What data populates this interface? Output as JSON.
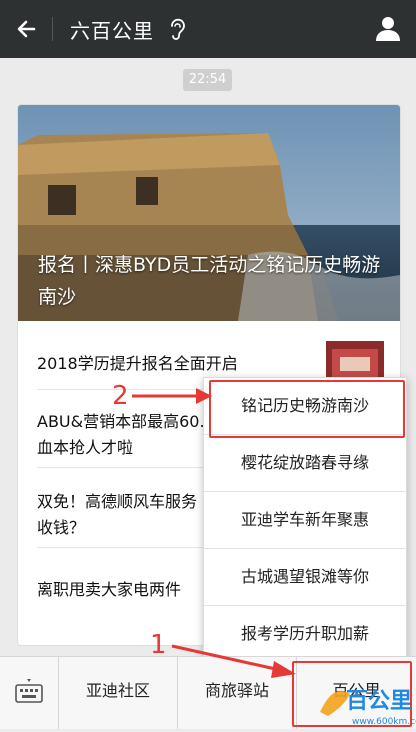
{
  "header": {
    "title": "六百公里"
  },
  "chat": {
    "time": "22:54"
  },
  "article": {
    "headline": "报名丨深惠BYD员工活动之铭记历史畅游南沙",
    "items": [
      {
        "text": "2018学历提升报名全面开启"
      },
      {
        "text": "ABU&营销本部最高60... 血本抢人才啦"
      },
      {
        "text": "双免！高德顺风车服务 不收钱？"
      },
      {
        "text": "离职甩卖大家电两件"
      }
    ]
  },
  "popup_menu": {
    "items": [
      "铭记历史畅游南沙",
      "樱花绽放踏春寻缘",
      "亚迪学车新年聚惠",
      "古城遇望银滩等你",
      "报考学历升职加薪"
    ]
  },
  "bottom_menu": {
    "items": [
      "亚迪社区",
      "商旅驿站",
      "百公里"
    ]
  },
  "annotations": {
    "step1": "1",
    "step2": "2"
  },
  "watermark": {
    "text": "百公里",
    "url_text": "www.600km.com"
  },
  "colors": {
    "accent": "#e53935",
    "topbar": "#2e3132"
  }
}
